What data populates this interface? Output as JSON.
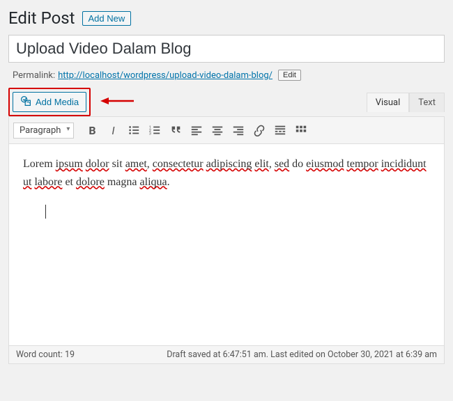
{
  "header": {
    "title": "Edit Post",
    "add_new": "Add New"
  },
  "title_input": "Upload Video Dalam Blog",
  "permalink": {
    "label": "Permalink:",
    "url": "http://localhost/wordpress/upload-video-dalam-blog/",
    "edit": "Edit"
  },
  "media": {
    "add_media": "Add Media"
  },
  "tabs": {
    "visual": "Visual",
    "text": "Text"
  },
  "toolbar": {
    "format": "Paragraph"
  },
  "content": {
    "text_parts": [
      {
        "t": "Lorem ",
        "err": false
      },
      {
        "t": "ipsum",
        "err": true
      },
      {
        "t": " ",
        "err": false
      },
      {
        "t": "dolor",
        "err": true
      },
      {
        "t": " sit ",
        "err": false
      },
      {
        "t": "amet",
        "err": true
      },
      {
        "t": ", ",
        "err": false
      },
      {
        "t": "consectetur",
        "err": true
      },
      {
        "t": " ",
        "err": false
      },
      {
        "t": "adipiscing",
        "err": true
      },
      {
        "t": " ",
        "err": false
      },
      {
        "t": "elit",
        "err": true
      },
      {
        "t": ", ",
        "err": false
      },
      {
        "t": "sed",
        "err": true
      },
      {
        "t": " do ",
        "err": false
      },
      {
        "t": "eiusmod",
        "err": true
      },
      {
        "t": " ",
        "err": false
      },
      {
        "t": "tempor",
        "err": true
      },
      {
        "t": " ",
        "err": false
      },
      {
        "t": "incididunt",
        "err": true
      },
      {
        "t": " ",
        "err": false
      },
      {
        "t": "ut",
        "err": true
      },
      {
        "t": " ",
        "err": false
      },
      {
        "t": "labore",
        "err": true
      },
      {
        "t": " et ",
        "err": false
      },
      {
        "t": "dolore",
        "err": true
      },
      {
        "t": " magna ",
        "err": false
      },
      {
        "t": "aliqua",
        "err": true
      },
      {
        "t": ".",
        "err": false
      }
    ]
  },
  "status": {
    "word_count_label": "Word count:",
    "word_count": "19",
    "draft_saved": "Draft saved at 6:47:51 am. Last edited on October 30, 2021 at 6:39 am"
  }
}
